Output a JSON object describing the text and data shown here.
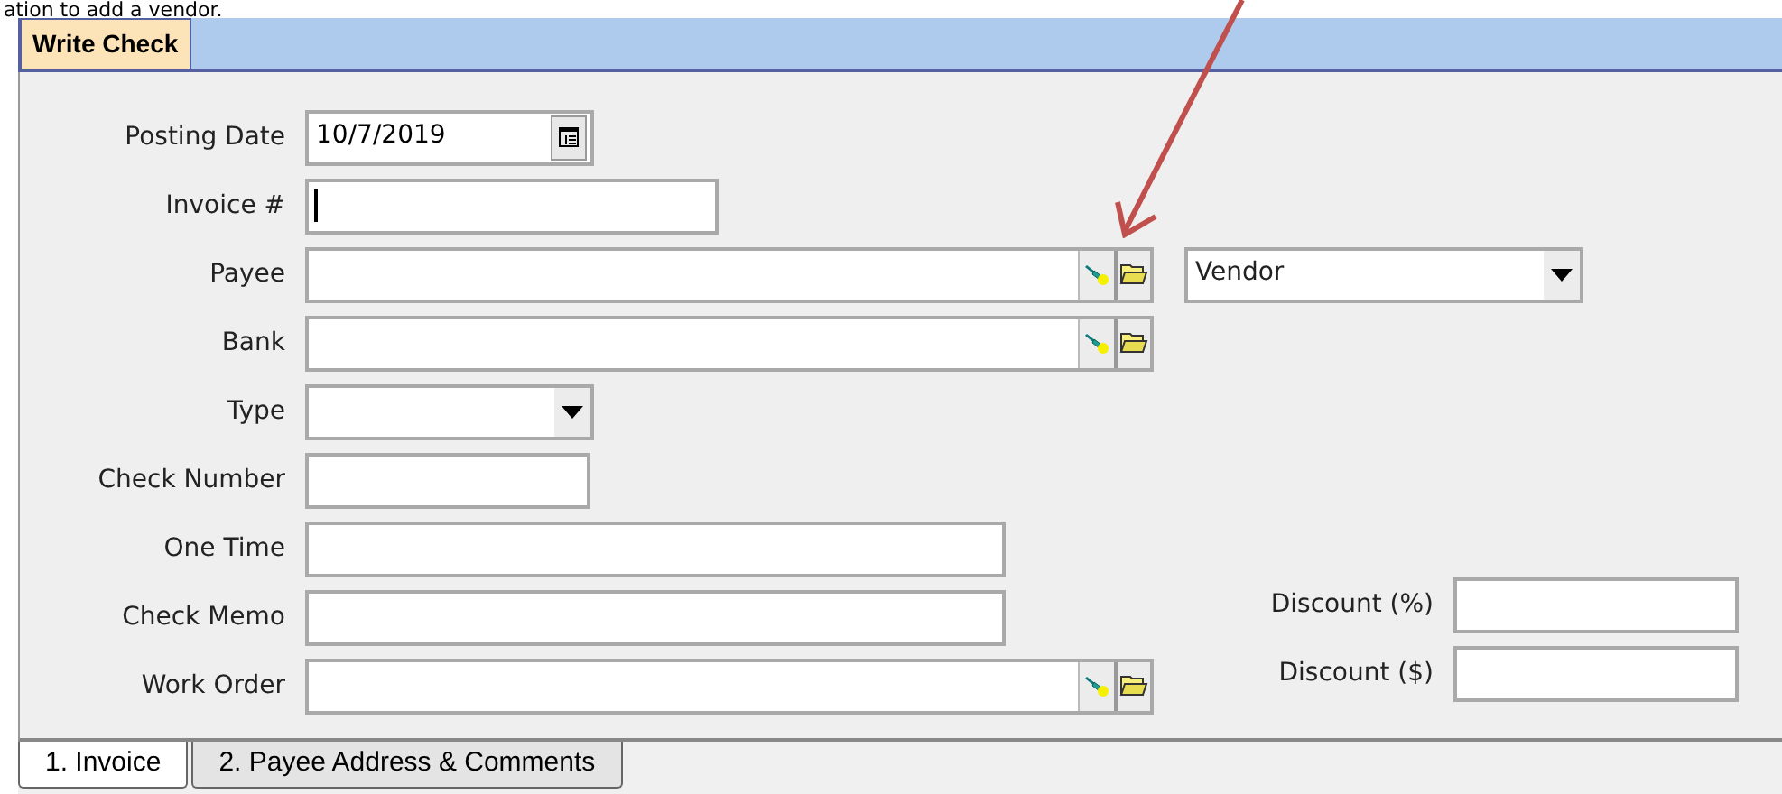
{
  "caption": "ation to add a vendor.",
  "window_tabs": [
    {
      "label": "Write Check",
      "selected": true
    }
  ],
  "fields": [
    {
      "label": "Posting Date",
      "kind": "date",
      "value": "10/7/2019"
    },
    {
      "label": "Invoice #",
      "kind": "text",
      "focused": true
    },
    {
      "label": "Payee",
      "kind": "lookup",
      "type_select": {
        "value": "Vendor"
      }
    },
    {
      "label": "Bank",
      "kind": "lookup"
    },
    {
      "label": "Type",
      "kind": "select"
    },
    {
      "label": "Check Number",
      "kind": "number"
    },
    {
      "label": "One Time",
      "kind": "memo"
    },
    {
      "label": "Check Memo",
      "kind": "memo",
      "side": {
        "label": "Discount (%)"
      }
    },
    {
      "label": "Work Order",
      "kind": "lookup",
      "side": {
        "label": "Discount ($)"
      }
    }
  ],
  "bottom_tabs": [
    {
      "label": "1. Invoice",
      "selected": true
    },
    {
      "label": "2. Payee Address & Comments",
      "selected": false
    }
  ]
}
